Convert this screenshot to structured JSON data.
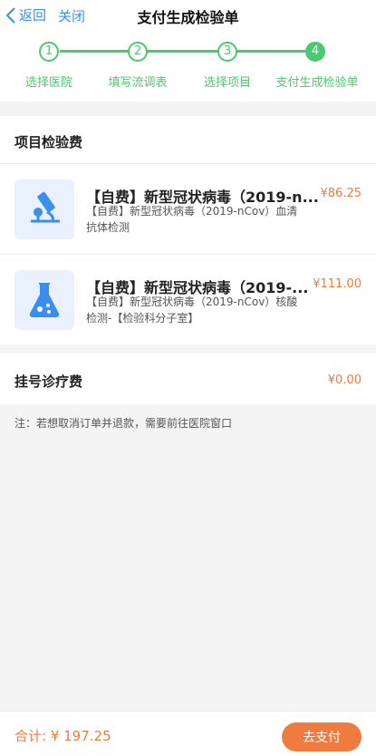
{
  "nav": {
    "back_label": "返回",
    "close_label": "关闭",
    "title": "支付生成检验单"
  },
  "stepper": {
    "steps": [
      {
        "number": "1",
        "label": "选择医院"
      },
      {
        "number": "2",
        "label": "填写流调表"
      },
      {
        "number": "3",
        "label": "选择项目"
      },
      {
        "number": "4",
        "label": "支付生成检验单"
      }
    ],
    "current_step": 4,
    "color": "#4cc96e"
  },
  "project_fee": {
    "title": "项目检验费",
    "items": [
      {
        "icon": "microscope-icon",
        "title": "【自费】新型冠状病毒（2019-n...",
        "price": "¥86.25",
        "desc": "【自费】新型冠状病毒（2019-nCov）血清抗体检测"
      },
      {
        "icon": "flask-icon",
        "title": "【自费】新型冠状病毒（2019-...",
        "price": "¥111.00",
        "desc": "【自费】新型冠状病毒（2019-nCov）核酸检测-【检验科分子室】"
      }
    ]
  },
  "registration": {
    "title": "挂号诊疗费",
    "price": "¥0.00"
  },
  "note": "注：若想取消订单并退款，需要前往医院窗口",
  "footer": {
    "total_label": "合计: ¥ 197.25",
    "pay_label": "去支付"
  },
  "colors": {
    "accent_blue": "#3a8ef0",
    "accent_orange": "#f07b3f",
    "icon_bg": "#e8f1fd"
  }
}
